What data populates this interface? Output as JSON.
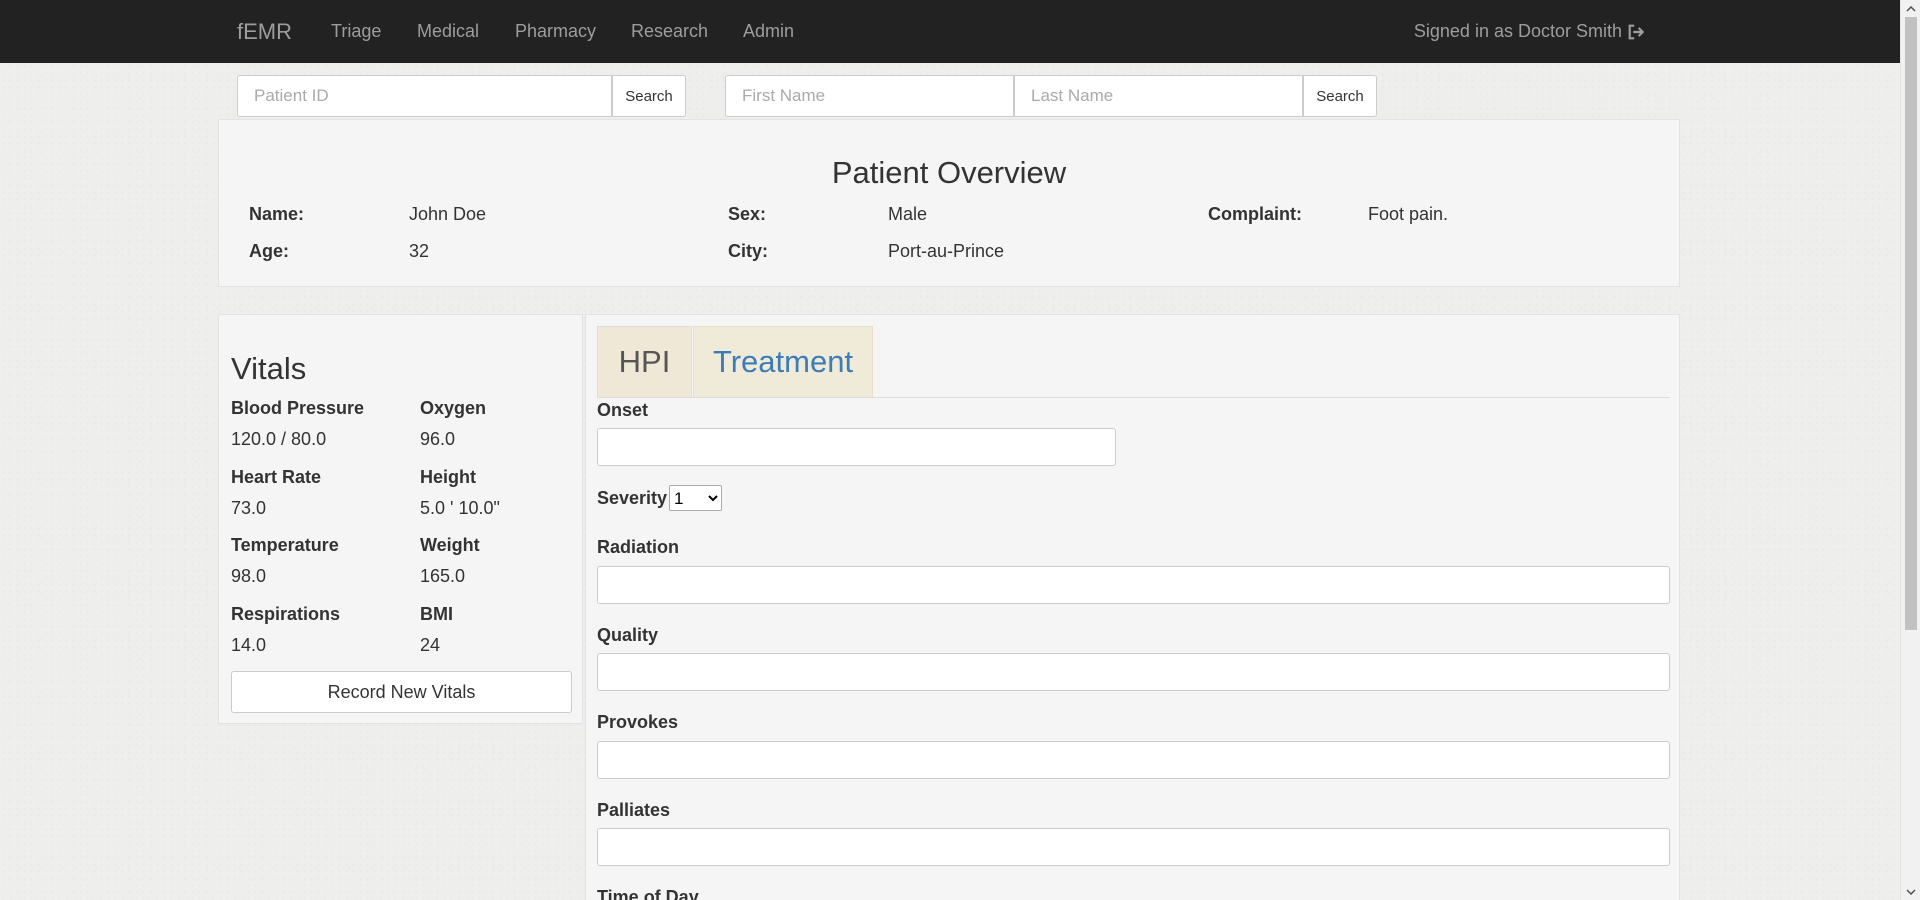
{
  "navbar": {
    "brand": "fEMR",
    "links": [
      "Triage",
      "Medical",
      "Pharmacy",
      "Research",
      "Admin"
    ],
    "signin": "Signed in as Doctor Smith",
    "signout_icon": "sign-out-icon"
  },
  "search": {
    "patient_id_placeholder": "Patient ID",
    "search_label": "Search",
    "first_name_placeholder": "First Name",
    "last_name_placeholder": "Last Name",
    "search2_label": "Search"
  },
  "overview": {
    "title": "Patient Overview",
    "name_label": "Name:",
    "name": "John Doe",
    "age_label": "Age:",
    "age": "32",
    "sex_label": "Sex:",
    "sex": "Male",
    "city_label": "City:",
    "city": "Port-au-Prince",
    "complaint_label": "Complaint:",
    "complaint": "Foot pain."
  },
  "vitals": {
    "title": "Vitals",
    "items": [
      {
        "label": "Blood Pressure",
        "value": "120.0 / 80.0"
      },
      {
        "label": "Oxygen",
        "value": "96.0"
      },
      {
        "label": "Heart Rate",
        "value": "73.0"
      },
      {
        "label": "Height",
        "value": "5.0 ' 10.0\""
      },
      {
        "label": "Temperature",
        "value": "98.0"
      },
      {
        "label": "Weight",
        "value": "165.0"
      },
      {
        "label": "Respirations",
        "value": "14.0"
      },
      {
        "label": "BMI",
        "value": "24"
      }
    ],
    "record_button": "Record New Vitals"
  },
  "hpi": {
    "tabs": [
      "HPI",
      "Treatment"
    ],
    "fields": {
      "onset": "Onset",
      "severity": "Severity",
      "severity_value": "1",
      "radiation": "Radiation",
      "quality": "Quality",
      "provokes": "Provokes",
      "palliates": "Palliates",
      "time_of_day": "Time of Day"
    }
  },
  "colors": {
    "navbar_bg": "#222222",
    "nav_text": "#9d9d9d",
    "panel_bg": "#f5f5f5",
    "tab_bg": "#f0ead9",
    "tab_active_text": "#3a7db8"
  }
}
